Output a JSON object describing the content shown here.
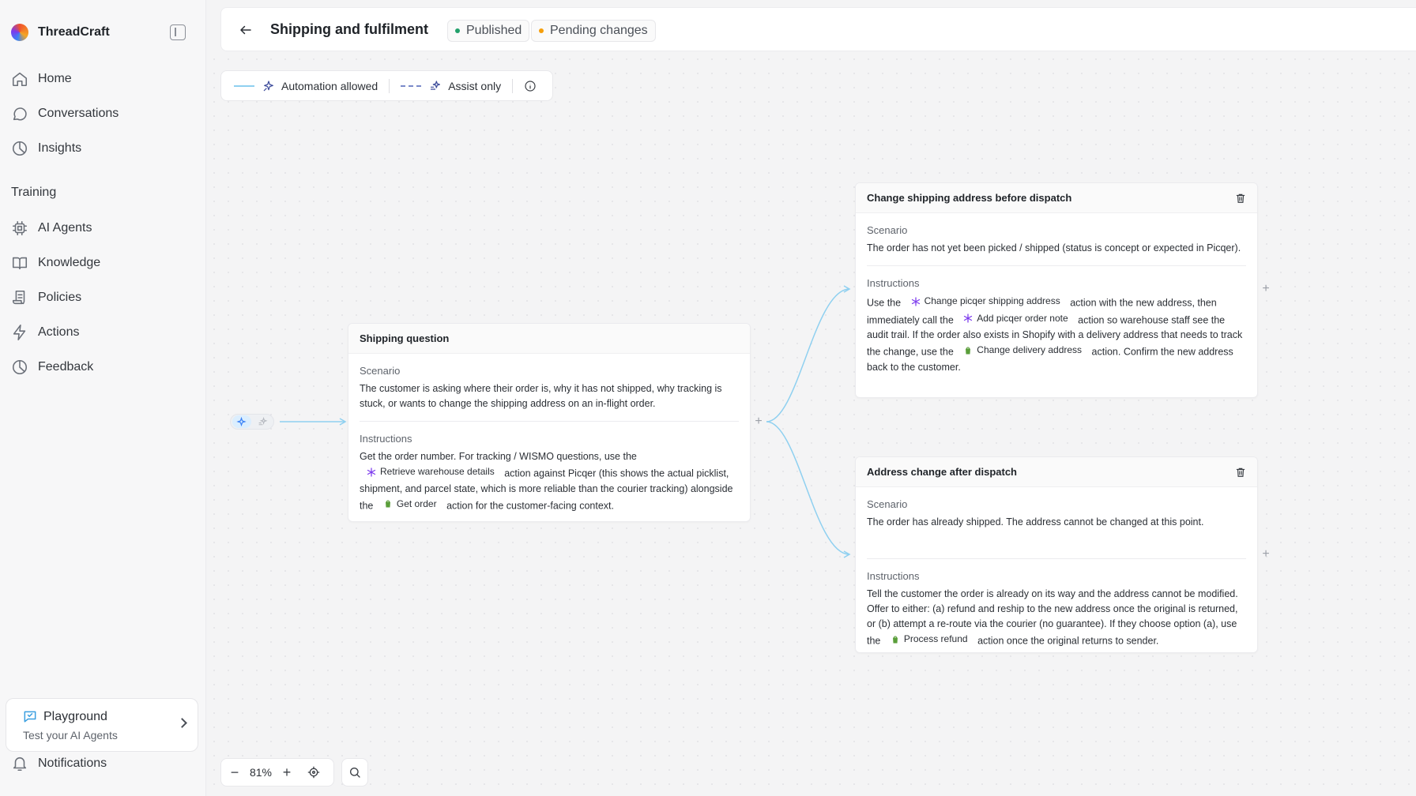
{
  "sidebar": {
    "brand": "ThreadCraft",
    "items": [
      {
        "label": "Home",
        "icon": "home-icon"
      },
      {
        "label": "Conversations",
        "icon": "chat-icon"
      },
      {
        "label": "Insights",
        "icon": "pie-chart-icon"
      }
    ],
    "section_label": "Training",
    "training_items": [
      {
        "label": "AI Agents",
        "icon": "chip-icon"
      },
      {
        "label": "Knowledge",
        "icon": "book-icon"
      },
      {
        "label": "Policies",
        "icon": "scroll-icon"
      },
      {
        "label": "Actions",
        "icon": "bolt-icon"
      },
      {
        "label": "Feedback",
        "icon": "pie-chart-icon"
      }
    ],
    "playground": {
      "title": "Playground",
      "subtitle": "Test your AI Agents"
    },
    "notifications": "Notifications"
  },
  "header": {
    "title": "Shipping and fulfilment",
    "status_published": "Published",
    "status_pending": "Pending changes",
    "published_color": "#22a06b",
    "pending_color": "#f59e0b"
  },
  "legend": {
    "automation": "Automation allowed",
    "assist": "Assist only"
  },
  "nodes": {
    "root": {
      "title": "Shipping question",
      "scenario_label": "Scenario",
      "scenario": "The customer is asking where their order is, why it has not shipped, why tracking is stuck, or wants to change the shipping address on an in-flight order.",
      "instructions_label": "Instructions",
      "i1": "Get the order number. For tracking / WISMO questions, use the",
      "chip1": "Retrieve warehouse details",
      "i2": "action against Picqer (this shows the actual picklist, shipment, and parcel state, which is more reliable than the courier tracking) alongside the",
      "chip2": "Get order",
      "i3": "action for the customer-facing context."
    },
    "change_before": {
      "title": "Change shipping address before dispatch",
      "scenario_label": "Scenario",
      "scenario": "The order has not yet been picked / shipped (status is concept or expected in Picqer).",
      "instructions_label": "Instructions",
      "i1": "Use the",
      "chip1": "Change picqer shipping address",
      "i2": "action with the new address, then immediately call the",
      "chip2": "Add picqer order note",
      "i3": "action so warehouse staff see the audit trail. If the order also exists in Shopify with a delivery address that needs to track the change, use the",
      "chip3": "Change delivery address",
      "i4": "action. Confirm the new address back to the customer."
    },
    "change_after": {
      "title": "Address change after dispatch",
      "scenario_label": "Scenario",
      "scenario": "The order has already shipped. The address cannot be changed at this point.",
      "instructions_label": "Instructions",
      "i1": "Tell the customer the order is already on its way and the address cannot be modified. Offer to either: (a) refund and reship to the new address once the original is returned, or (b) attempt a re-route via the courier (no guarantee). If they choose option (a), use the",
      "chip1": "Process refund",
      "i2": "action once the original returns to sender."
    }
  },
  "zoom": {
    "level": "81%"
  },
  "colors": {
    "picqer_accent": "#7c3aed",
    "shopify_green": "#5a9e3a",
    "edge_color": "#8fd0f0"
  }
}
